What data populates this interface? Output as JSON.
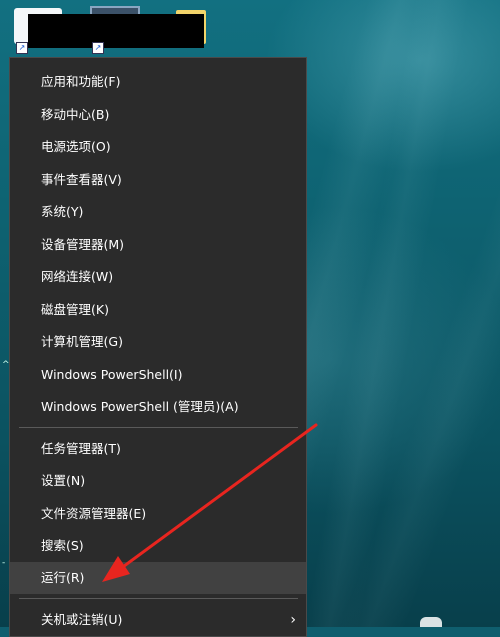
{
  "colors": {
    "menu_background": "#2b2b2b",
    "menu_highlight": "#414141",
    "menu_text": "#ffffff",
    "annotation_arrow": "#e8251f"
  },
  "menu": {
    "group1": [
      "应用和功能(F)",
      "移动中心(B)",
      "电源选项(O)",
      "事件查看器(V)",
      "系统(Y)",
      "设备管理器(M)",
      "网络连接(W)",
      "磁盘管理(K)",
      "计算机管理(G)",
      "Windows PowerShell(I)",
      "Windows PowerShell (管理员)(A)"
    ],
    "group2": [
      "任务管理器(T)",
      "设置(N)",
      "文件资源管理器(E)",
      "搜索(S)",
      "运行(R)"
    ],
    "group3": [
      "关机或注销(U)"
    ],
    "highlighted_item": "运行(R)",
    "submenu_icon": "chevron-right-icon"
  }
}
